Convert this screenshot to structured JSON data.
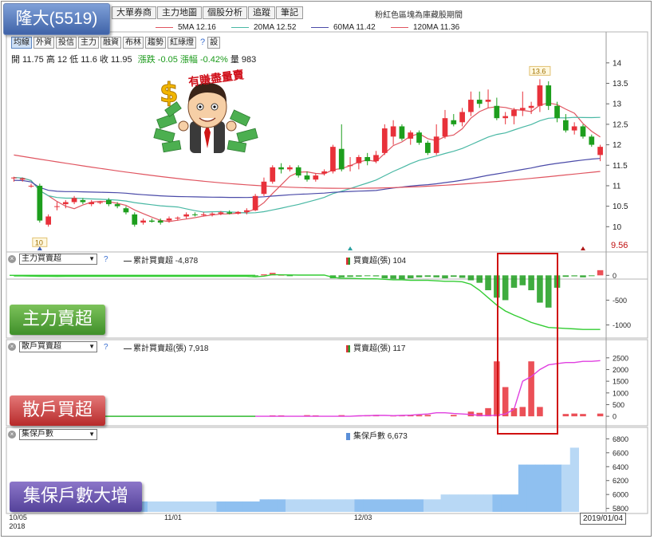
{
  "stock_label": "隆大(5519)",
  "tabs": [
    "大單券商",
    "主力地圖",
    "個股分析",
    "追蹤",
    "筆記"
  ],
  "chart_heading": "粉紅色區塊為庫藏股期間",
  "ma_legend": [
    {
      "label": "5MA 12.16",
      "color": "#e05560"
    },
    {
      "label": "20MA 12.52",
      "color": "#49b8a4"
    },
    {
      "label": "60MA 11.42",
      "color": "#4a4aa8"
    },
    {
      "label": "120MA 11.36",
      "color": "#e05560"
    }
  ],
  "toolbar": [
    "均線",
    "外資",
    "投信",
    "主力",
    "融資",
    "布林",
    "趨勢",
    "紅綠燈",
    "?",
    "設"
  ],
  "ohlc": {
    "text": "開 11.75  高 12  低 11.6  收 11.95",
    "change": "漲跌 -0.05  漲幅 -0.42%",
    "volume": "量 983"
  },
  "mascot_text": "有賺盡量賣",
  "panels": {
    "main_force": {
      "select": "主力買賣超",
      "line_legend": "累計買賣超 -4,878",
      "bar_legend": "買賣超(張) 104"
    },
    "retail": {
      "select": "散戶買賣超",
      "line_legend": "累計買賣超(張) 7,918",
      "bar_legend": "買賣超(張) 117"
    },
    "holders": {
      "select": "集保戶數",
      "bar_legend": "集保戶數 6,673"
    }
  },
  "callouts": {
    "main_force": "主力賣超",
    "retail": "散戶買超",
    "holders": "集保戶數大增"
  },
  "x_axis": {
    "labels": [
      "10/05\n2018",
      "11/01",
      "12/03",
      "2019"
    ],
    "current_date": "2019/01/04"
  },
  "colors": {
    "up": "#e8313a",
    "down": "#1d9e1d",
    "highlight": "#d01010",
    "holders_bar": "#8fc0f0"
  },
  "chart_data": [
    {
      "type": "candlestick",
      "y_ticks": [
        10,
        10.5,
        11,
        11.5,
        12,
        12.5,
        13,
        13.5,
        14
      ],
      "ylim": [
        9.5,
        14.25
      ],
      "low_marker": "10",
      "high_marker": "13.6",
      "last_low_label": "9.56",
      "candles": [
        [
          11.18,
          11.22,
          11.1,
          11.2
        ],
        [
          11.15,
          11.2,
          11.1,
          11.18
        ],
        [
          11.0,
          11.05,
          10.95,
          11.0
        ],
        [
          11.0,
          11.05,
          10.1,
          10.15
        ],
        [
          10.05,
          10.3,
          10.0,
          10.25
        ],
        [
          10.5,
          10.6,
          10.4,
          10.5
        ],
        [
          10.55,
          10.65,
          10.45,
          10.6
        ],
        [
          10.6,
          10.75,
          10.55,
          10.7
        ],
        [
          10.65,
          10.7,
          10.55,
          10.6
        ],
        [
          10.55,
          10.65,
          10.5,
          10.6
        ],
        [
          10.58,
          10.62,
          10.55,
          10.6
        ],
        [
          10.65,
          10.7,
          10.5,
          10.55
        ],
        [
          10.55,
          10.6,
          10.45,
          10.5
        ],
        [
          10.45,
          10.5,
          10.3,
          10.35
        ],
        [
          10.3,
          10.35,
          10.0,
          10.05
        ],
        [
          10.1,
          10.2,
          10.05,
          10.15
        ],
        [
          10.15,
          10.2,
          10.1,
          10.12
        ],
        [
          10.15,
          10.2,
          10.05,
          10.1
        ],
        [
          10.15,
          10.25,
          10.1,
          10.2
        ],
        [
          10.2,
          10.25,
          10.15,
          10.22
        ],
        [
          10.25,
          10.35,
          10.2,
          10.3
        ],
        [
          10.3,
          10.35,
          10.25,
          10.28
        ],
        [
          10.28,
          10.35,
          10.25,
          10.3
        ],
        [
          10.3,
          10.35,
          10.25,
          10.32
        ],
        [
          10.32,
          10.38,
          10.28,
          10.35
        ],
        [
          10.35,
          10.4,
          10.3,
          10.32
        ],
        [
          10.32,
          10.38,
          10.3,
          10.36
        ],
        [
          10.36,
          10.45,
          10.3,
          10.4
        ],
        [
          10.4,
          10.8,
          10.38,
          10.75
        ],
        [
          10.8,
          11.2,
          10.75,
          11.1
        ],
        [
          11.1,
          11.5,
          11.05,
          11.45
        ],
        [
          11.45,
          11.55,
          11.3,
          11.4
        ],
        [
          11.4,
          11.5,
          11.35,
          11.45
        ],
        [
          11.45,
          11.5,
          11.2,
          11.25
        ],
        [
          11.25,
          11.35,
          11.1,
          11.15
        ],
        [
          11.15,
          11.3,
          11.1,
          11.25
        ],
        [
          11.3,
          11.4,
          11.25,
          11.35
        ],
        [
          11.35,
          12.0,
          11.3,
          11.95
        ],
        [
          11.9,
          12.5,
          11.35,
          11.4
        ],
        [
          11.5,
          11.7,
          11.35,
          11.5
        ],
        [
          11.55,
          11.75,
          11.4,
          11.7
        ],
        [
          11.7,
          11.8,
          11.5,
          11.6
        ],
        [
          11.6,
          11.85,
          11.55,
          11.75
        ],
        [
          11.8,
          12.5,
          11.75,
          12.4
        ],
        [
          12.2,
          12.6,
          12.0,
          12.45
        ],
        [
          12.45,
          12.5,
          12.1,
          12.15
        ],
        [
          12.15,
          12.35,
          12.0,
          12.3
        ],
        [
          12.3,
          12.35,
          12.0,
          12.05
        ],
        [
          12.05,
          12.1,
          11.75,
          11.8
        ],
        [
          11.8,
          12.5,
          11.75,
          12.2
        ],
        [
          12.2,
          12.85,
          12.15,
          12.65
        ],
        [
          12.6,
          12.75,
          12.45,
          12.5
        ],
        [
          12.55,
          12.9,
          12.45,
          12.8
        ],
        [
          12.8,
          13.3,
          12.7,
          13.1
        ],
        [
          13.1,
          13.3,
          12.9,
          13.0
        ],
        [
          13.05,
          13.35,
          12.9,
          13.1
        ],
        [
          12.95,
          13.15,
          12.6,
          12.65
        ],
        [
          12.65,
          12.8,
          12.5,
          12.7
        ],
        [
          12.7,
          12.9,
          12.5,
          12.85
        ],
        [
          12.85,
          13.3,
          12.7,
          12.9
        ],
        [
          12.9,
          13.05,
          12.75,
          12.95
        ],
        [
          12.95,
          13.6,
          12.8,
          13.45
        ],
        [
          13.45,
          13.55,
          12.85,
          12.95
        ],
        [
          12.95,
          13.05,
          12.55,
          12.65
        ],
        [
          12.6,
          12.75,
          12.3,
          12.35
        ],
        [
          12.35,
          12.55,
          12.25,
          12.45
        ],
        [
          12.45,
          12.5,
          12.15,
          12.2
        ],
        [
          12.2,
          12.25,
          11.95,
          12.0
        ],
        [
          11.75,
          12.0,
          11.6,
          11.95
        ]
      ]
    },
    {
      "type": "bar+line",
      "name": "主力買賣超",
      "y_ticks": [
        0,
        -500,
        -1000
      ],
      "ylim": [
        -1200,
        150
      ],
      "bars": [
        0,
        0,
        0,
        0,
        0,
        0,
        0,
        0,
        0,
        0,
        0,
        0,
        0,
        0,
        0,
        0,
        0,
        0,
        0,
        0,
        0,
        0,
        0,
        0,
        0,
        0,
        0,
        0,
        -10,
        20,
        50,
        10,
        -5,
        0,
        0,
        0,
        0,
        -60,
        -40,
        -30,
        -25,
        -10,
        -20,
        -60,
        -70,
        -80,
        -60,
        -40,
        -30,
        -40,
        -60,
        -30,
        -50,
        -100,
        -150,
        -300,
        -450,
        -500,
        -250,
        -200,
        -300,
        -550,
        -650,
        -250,
        -30,
        -20,
        -40,
        -10,
        104
      ],
      "line": [
        -10,
        -12,
        -15,
        -20,
        -20,
        -22,
        -20,
        -18,
        -18,
        -18,
        -20,
        -20,
        -20,
        -20,
        -20,
        -20,
        -20,
        -20,
        -20,
        -20,
        -20,
        -20,
        -20,
        -20,
        -20,
        -20,
        -20,
        -20,
        -30,
        -15,
        15,
        10,
        8,
        5,
        5,
        5,
        5,
        -40,
        -60,
        -60,
        -65,
        -70,
        -70,
        -80,
        -90,
        -90,
        -100,
        -100,
        -100,
        -110,
        -120,
        -120,
        -130,
        -180,
        -300,
        -450,
        -600,
        -720,
        -800,
        -870,
        -950,
        -1000,
        -1050,
        -1060,
        -1070,
        -1080,
        -1090,
        -1090,
        -1090
      ]
    },
    {
      "type": "bar+line",
      "name": "散戶買賣超",
      "y_ticks": [
        0,
        500,
        1000,
        1500,
        2000,
        2500
      ],
      "ylim": [
        -200,
        2800
      ],
      "bars": [
        0,
        0,
        0,
        0,
        0,
        0,
        0,
        0,
        0,
        0,
        0,
        0,
        0,
        0,
        0,
        0,
        0,
        0,
        0,
        0,
        0,
        0,
        0,
        0,
        0,
        0,
        0,
        0,
        0,
        0,
        40,
        40,
        0,
        0,
        50,
        40,
        0,
        0,
        50,
        0,
        40,
        50,
        60,
        0,
        30,
        50,
        60,
        50,
        60,
        0,
        0,
        60,
        0,
        200,
        150,
        350,
        2350,
        1250,
        350,
        400,
        2350,
        400,
        0,
        0,
        100,
        120,
        100,
        0,
        117
      ],
      "line": [
        0,
        0,
        0,
        0,
        0,
        0,
        0,
        0,
        0,
        0,
        0,
        0,
        0,
        0,
        0,
        0,
        0,
        0,
        0,
        0,
        0,
        0,
        0,
        0,
        0,
        0,
        0,
        0,
        0,
        0,
        0,
        0,
        0,
        0,
        0,
        0,
        0,
        0,
        0,
        0,
        20,
        30,
        40,
        40,
        30,
        40,
        50,
        80,
        100,
        150,
        150,
        120,
        100,
        80,
        40,
        30,
        50,
        100,
        300,
        1500,
        1700,
        2000,
        2200,
        2250,
        2300,
        2300,
        2350,
        2350,
        2380
      ]
    },
    {
      "type": "bar",
      "name": "集保戶數",
      "y_ticks": [
        5800,
        6000,
        6200,
        6400,
        6600,
        6800
      ],
      "ylim": [
        5750,
        6850
      ],
      "bars": [
        5900,
        5900,
        5900,
        5900,
        5900,
        5900,
        5900,
        5900,
        5900,
        5900,
        5900,
        5900,
        5900,
        5900,
        5900,
        5900,
        5900,
        5900,
        5900,
        5900,
        5900,
        5900,
        5900,
        5900,
        5900,
        5900,
        5900,
        5900,
        5900,
        5930,
        5930,
        5930,
        5930,
        5930,
        5930,
        5930,
        5930,
        5930,
        5930,
        5930,
        5930,
        5930,
        5930,
        5930,
        5930,
        5930,
        5930,
        5930,
        5930,
        5930,
        6000,
        6000,
        6000,
        6000,
        6000,
        6000,
        6000,
        6000,
        6000,
        6430,
        6430,
        6430,
        6430,
        6430,
        6430,
        6673,
        6673,
        6673,
        6673
      ]
    }
  ]
}
